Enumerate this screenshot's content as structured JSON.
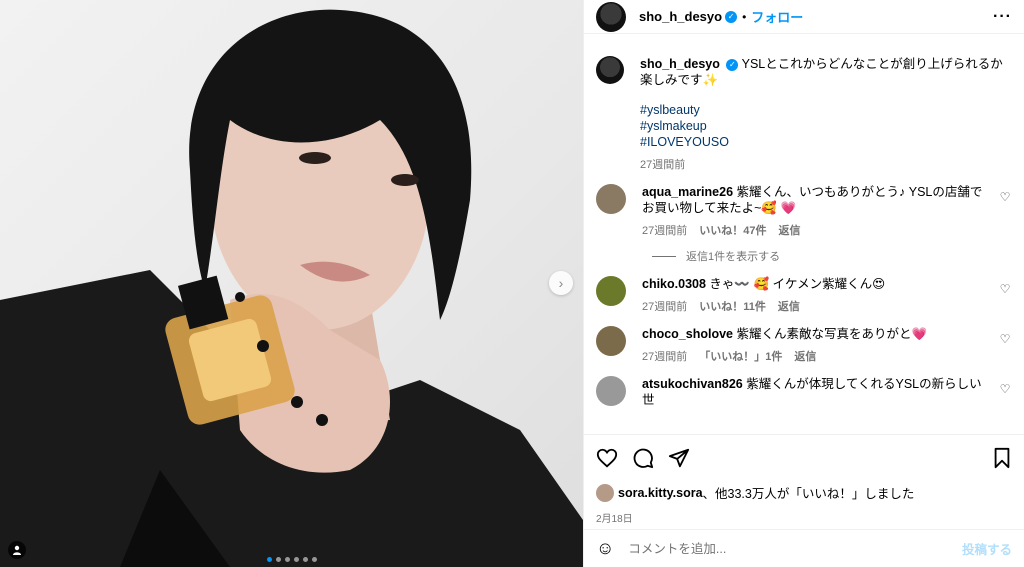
{
  "post": {
    "username": "sho_h_desyo",
    "follow_label": "フォロー",
    "separator": "•",
    "caption": "YSLとこれからどんなことが創り上げられるか楽しみです✨",
    "hashtags": [
      "#yslbeauty",
      "#yslmakeup",
      "#ILOVEYOUSO"
    ],
    "caption_time": "27週間前"
  },
  "comments": [
    {
      "username": "aqua_marine26",
      "text": "紫耀くん、いつもありがとう♪ YSLの店舗でお買い物して来たよ~🥰 💗",
      "time": "27週間前",
      "likes": "いいね！47件",
      "reply": "返信",
      "avatar_color": "#8a7a63"
    },
    {
      "username": "chiko.0308",
      "text": "きゃ〰️ 🥰 イケメン紫耀くん😍",
      "time": "27週間前",
      "likes": "いいね！11件",
      "reply": "返信",
      "avatar_color": "#6a7a2a"
    },
    {
      "username": "choco_sholove",
      "text": "紫耀くん素敵な写真をありがと💗",
      "time": "27週間前",
      "likes": "「いいね！」1件",
      "reply": "返信",
      "avatar_color": "#7c6b4a"
    },
    {
      "username": "atsukochivan826",
      "text": "紫耀くんが体現してくれるYSLの新らしい世",
      "time": "",
      "likes": "",
      "reply": "",
      "avatar_color": "#999999"
    }
  ],
  "replies_toggle": "返信1件を表示する",
  "likes_line": {
    "user": "sora.kitty.sora",
    "rest": "、他33.3万人が「いいね！」しました"
  },
  "date": "2月18日",
  "add_comment": {
    "placeholder": "コメントを追加...",
    "post_label": "投稿する"
  },
  "icons": {
    "like": "heart-icon",
    "comment": "comment-icon",
    "share": "share-icon",
    "save": "bookmark-icon",
    "more": "more-icon",
    "next": "chevron-right-icon",
    "tag": "user-tag-icon",
    "emoji": "emoji-icon"
  },
  "colors": {
    "accent": "#0095f6",
    "muted": "#737373",
    "hashtag": "#00376b"
  },
  "media": {
    "slide_count": 6,
    "active_slide": 1
  }
}
